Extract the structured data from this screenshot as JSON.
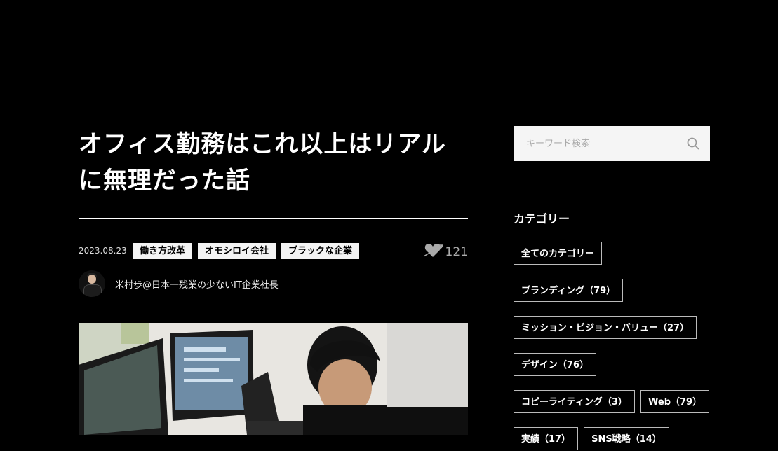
{
  "article": {
    "title": "オフィス勤務はこれ以上はリアルに無理だった話",
    "date": "2023.08.23",
    "tags": [
      "働き方改革",
      "オモシロイ会社",
      "ブラックな企業"
    ],
    "like_count": "121",
    "author_name": "米村歩@日本一残業の少ないIT企業社長"
  },
  "sidebar": {
    "search_placeholder": "キーワード検索",
    "category_heading": "カテゴリー",
    "categories": [
      "全てのカテゴリー",
      "ブランディング（79）",
      "ミッション・ビジョン・バリュー（27）",
      "デザイン（76）",
      "コピーライティング（3）",
      "Web（79）",
      "実績（17）",
      "SNS戦略（14）"
    ]
  },
  "icons": {
    "like": "heart-arrow-icon",
    "search": "search-icon"
  },
  "colors": {
    "background": "#000000",
    "tag_bg": "#f4f4f4",
    "search_bg": "#f5f5f5"
  }
}
